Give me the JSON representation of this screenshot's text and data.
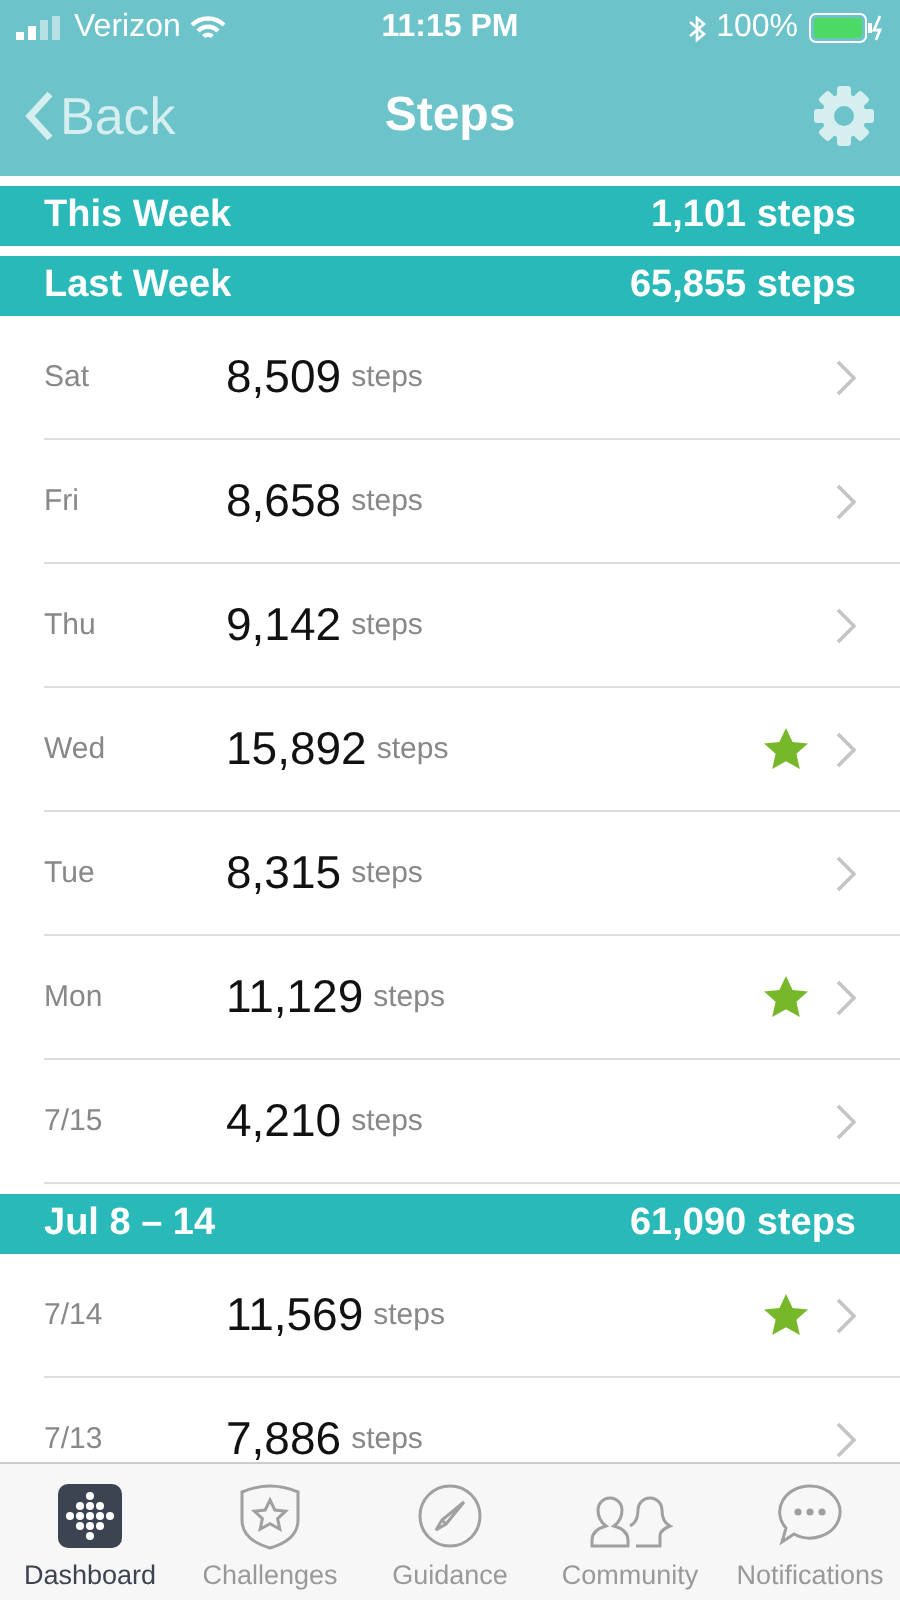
{
  "status_bar": {
    "carrier": "Verizon",
    "time": "11:15 PM",
    "battery": "100%"
  },
  "nav": {
    "back": "Back",
    "title": "Steps"
  },
  "sections": [
    {
      "title": "This Week",
      "total": "1,101 steps"
    },
    {
      "title": "Last Week",
      "total": "65,855 steps",
      "days": [
        {
          "day": "Sat",
          "steps": "8,509",
          "unit": "steps",
          "goal_met": false
        },
        {
          "day": "Fri",
          "steps": "8,658",
          "unit": "steps",
          "goal_met": false
        },
        {
          "day": "Thu",
          "steps": "9,142",
          "unit": "steps",
          "goal_met": false
        },
        {
          "day": "Wed",
          "steps": "15,892",
          "unit": "steps",
          "goal_met": true
        },
        {
          "day": "Tue",
          "steps": "8,315",
          "unit": "steps",
          "goal_met": false
        },
        {
          "day": "Mon",
          "steps": "11,129",
          "unit": "steps",
          "goal_met": true
        },
        {
          "day": "7/15",
          "steps": "4,210",
          "unit": "steps",
          "goal_met": false
        }
      ]
    },
    {
      "title": "Jul 8 – 14",
      "total": "61,090 steps",
      "days": [
        {
          "day": "7/14",
          "steps": "11,569",
          "unit": "steps",
          "goal_met": true
        },
        {
          "day": "7/13",
          "steps": "7,886",
          "unit": "steps",
          "goal_met": false
        }
      ]
    }
  ],
  "tabs": [
    {
      "kind": "dashboard",
      "label": "Dashboard",
      "selected": true
    },
    {
      "kind": "challenges",
      "label": "Challenges",
      "selected": false
    },
    {
      "kind": "guidance",
      "label": "Guidance",
      "selected": false
    },
    {
      "kind": "community",
      "label": "Community",
      "selected": false
    },
    {
      "kind": "notifications",
      "label": "Notifications",
      "selected": false
    }
  ]
}
